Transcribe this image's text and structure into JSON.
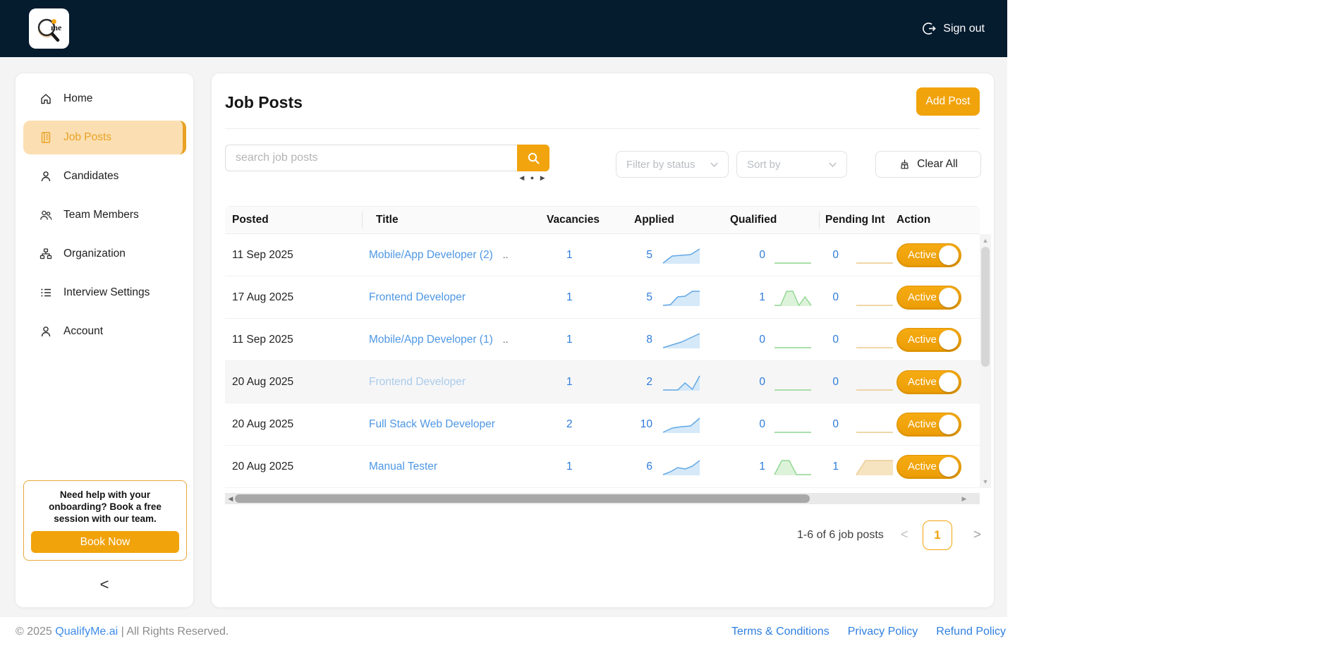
{
  "colors": {
    "navbar_navy": "#051B2E",
    "accent_orange": "#F1A30C",
    "active_item_bg": "#FBDFB2",
    "active_item_stripe": "#E9A124",
    "link_blue": "#4E97E3",
    "number_blue": "#2D7BDA",
    "muted_link_blue": "#ABCBEA",
    "applied_spark_line": "#63A8E3",
    "applied_spark_fill": "#D5E9F9",
    "qualified_spark_line": "#94D794",
    "qualified_spark_fill": "#DCF3DA",
    "pending_spark_line": "#EBCE96",
    "pending_spark_fill": "#F6E3C0"
  },
  "navbar": {
    "logo_text": "me",
    "sign_out_label": "Sign out"
  },
  "sidebar": {
    "items": [
      {
        "label": "Home",
        "icon": "home-icon",
        "active": false
      },
      {
        "label": "Job Posts",
        "icon": "job-posts-icon",
        "active": true
      },
      {
        "label": "Candidates",
        "icon": "person-icon",
        "active": false
      },
      {
        "label": "Team Members",
        "icon": "people-icon",
        "active": false
      },
      {
        "label": "Organization",
        "icon": "org-chart-icon",
        "active": false
      },
      {
        "label": "Interview Settings",
        "icon": "list-icon",
        "active": false
      },
      {
        "label": "Account",
        "icon": "person-icon",
        "active": false
      }
    ],
    "help_box": {
      "text": "Need help with your onboarding? Book a free session with our team.",
      "button_label": "Book Now"
    },
    "collapse_glyph": "<"
  },
  "main": {
    "title": "Job Posts",
    "add_post_label": "Add Post",
    "search": {
      "placeholder": "search job posts",
      "value": ""
    },
    "search_nav_glyphs": "◀ ● ▶",
    "filter_placeholder": "Filter by status",
    "sort_placeholder": "Sort by",
    "clear_all_label": "Clear All",
    "table": {
      "columns": [
        "Posted",
        "Title",
        "Vacancies",
        "Applied",
        "Qualified",
        "Pending Int",
        "Action"
      ],
      "rows": [
        {
          "posted": "11 Sep 2025",
          "title": "Mobile/App Developer (2)",
          "truncated": "..",
          "vacancies": "1",
          "applied": "5",
          "applied_trend": [
            0,
            5,
            5.5,
            6,
            10
          ],
          "qualified": "0",
          "qualified_trend": [
            0,
            0,
            0,
            0,
            0
          ],
          "pending": "0",
          "pending_trend": [
            0,
            0,
            0,
            0,
            0
          ],
          "status": "Active",
          "muted": false
        },
        {
          "posted": "17 Aug 2025",
          "title": "Frontend Developer",
          "truncated": "",
          "vacancies": "1",
          "applied": "5",
          "applied_trend": [
            0,
            0.5,
            6,
            6.5,
            10,
            10
          ],
          "qualified": "1",
          "qualified_trend": [
            0,
            0,
            10,
            10,
            0,
            6,
            0
          ],
          "pending": "0",
          "pending_trend": [
            0,
            0,
            0,
            0,
            0
          ],
          "status": "Active",
          "muted": false
        },
        {
          "posted": "11 Sep 2025",
          "title": "Mobile/App Developer (1)",
          "truncated": "..",
          "vacancies": "1",
          "applied": "8",
          "applied_trend": [
            0,
            2,
            4,
            7,
            10
          ],
          "qualified": "0",
          "qualified_trend": [
            0,
            0,
            0,
            0,
            0
          ],
          "pending": "0",
          "pending_trend": [
            0,
            0,
            0,
            0,
            0
          ],
          "status": "Active",
          "muted": false
        },
        {
          "posted": "20 Aug 2025",
          "title": "Frontend Developer",
          "truncated": "",
          "vacancies": "1",
          "applied": "2",
          "applied_trend": [
            0,
            0,
            0,
            5,
            0.5,
            10
          ],
          "qualified": "0",
          "qualified_trend": [
            0,
            0,
            0,
            0,
            0
          ],
          "pending": "0",
          "pending_trend": [
            0,
            0,
            0,
            0,
            0
          ],
          "status": "Active",
          "muted": true
        },
        {
          "posted": "20 Aug 2025",
          "title": "Full Stack Web Developer",
          "truncated": "",
          "vacancies": "2",
          "applied": "10",
          "applied_trend": [
            0,
            3,
            4,
            4.5,
            10
          ],
          "qualified": "0",
          "qualified_trend": [
            0,
            0,
            0,
            0,
            0
          ],
          "pending": "0",
          "pending_trend": [
            0,
            0,
            0,
            0,
            0
          ],
          "status": "Active",
          "muted": false
        },
        {
          "posted": "20 Aug 2025",
          "title": "Manual Tester",
          "truncated": "",
          "vacancies": "1",
          "applied": "6",
          "applied_trend": [
            0,
            2,
            5,
            4,
            6,
            10
          ],
          "qualified": "1",
          "qualified_trend": [
            0,
            10,
            10,
            0,
            0,
            0
          ],
          "pending": "1",
          "pending_trend": [
            0,
            10,
            10,
            10,
            10
          ],
          "status": "Active",
          "muted": false
        }
      ]
    },
    "pagination": {
      "summary": "1-6 of 6 job posts",
      "page": "1",
      "prev_glyph": "<",
      "next_glyph": ">"
    }
  },
  "footer": {
    "copyright_prefix": "© 2025 ",
    "brand": "QualifyMe.ai",
    "copyright_suffix": " | All Rights Reserved.",
    "links": [
      "Terms & Conditions",
      "Privacy Policy",
      "Refund Policy"
    ]
  }
}
